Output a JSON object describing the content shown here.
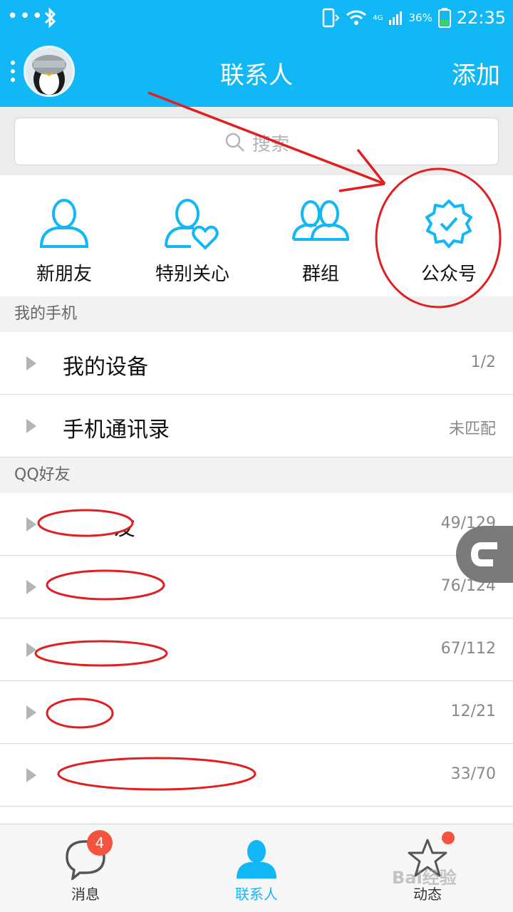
{
  "status_bar": {
    "time": "22:35",
    "battery": "36%",
    "network": "4G"
  },
  "header": {
    "title": "联系人",
    "add_label": "添加"
  },
  "search": {
    "placeholder": "搜索"
  },
  "shortcuts": [
    {
      "label": "新朋友",
      "icon": "person-icon"
    },
    {
      "label": "特别关心",
      "icon": "person-heart-icon"
    },
    {
      "label": "群组",
      "icon": "group-icon"
    },
    {
      "label": "公众号",
      "icon": "verified-badge-icon"
    }
  ],
  "sections": {
    "my_phone": "我的手机",
    "qq_friends": "QQ好友"
  },
  "my_phone_rows": [
    {
      "name": "我的设备",
      "count": "1/2"
    },
    {
      "name": "手机通讯录",
      "count": "未匹配"
    }
  ],
  "friend_groups": [
    {
      "name": "友",
      "count": "49/129"
    },
    {
      "name": "",
      "count": "76/124"
    },
    {
      "name": "",
      "count": "67/112"
    },
    {
      "name": "",
      "count": "12/21"
    },
    {
      "name": "",
      "count": "33/70"
    }
  ],
  "tabs": [
    {
      "label": "消息",
      "badge": "4"
    },
    {
      "label": "联系人"
    },
    {
      "label": "动态"
    }
  ],
  "watermark": "Bai经验",
  "colors": {
    "brand": "#12b7f5",
    "badge": "#f5533d",
    "annotation": "#e02020"
  }
}
